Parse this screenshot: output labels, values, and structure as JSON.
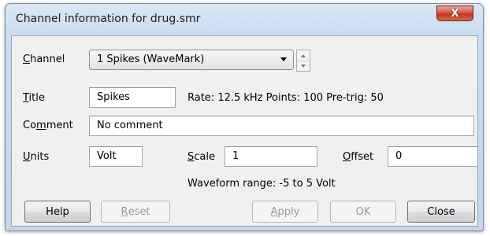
{
  "window": {
    "title": "Channel information for drug.smr",
    "close_glyph": "X"
  },
  "form": {
    "channel": {
      "label_u": "C",
      "label_rest": "hannel",
      "value": "1 Spikes (WaveMark)"
    },
    "title": {
      "label_u": "T",
      "label_rest": "itle",
      "value": "Spikes"
    },
    "info_line": "Rate: 12.5 kHz  Points: 100  Pre-trig: 50",
    "comment": {
      "label_pre": "Co",
      "label_u": "m",
      "label_rest": "ment",
      "value": "No comment"
    },
    "units": {
      "label_u": "U",
      "label_rest": "nits",
      "value": "Volt"
    },
    "scale": {
      "label_u": "S",
      "label_rest": "cale",
      "value": "1"
    },
    "offset": {
      "label_u": "O",
      "label_rest": "ffset",
      "value": "0"
    },
    "waveform_range": "Waveform range: -5 to 5 Volt"
  },
  "buttons": {
    "help": "Help",
    "reset_u": "R",
    "reset_rest": "eset",
    "apply_u": "A",
    "apply_rest": "pply",
    "ok": "OK",
    "close": "Close"
  }
}
